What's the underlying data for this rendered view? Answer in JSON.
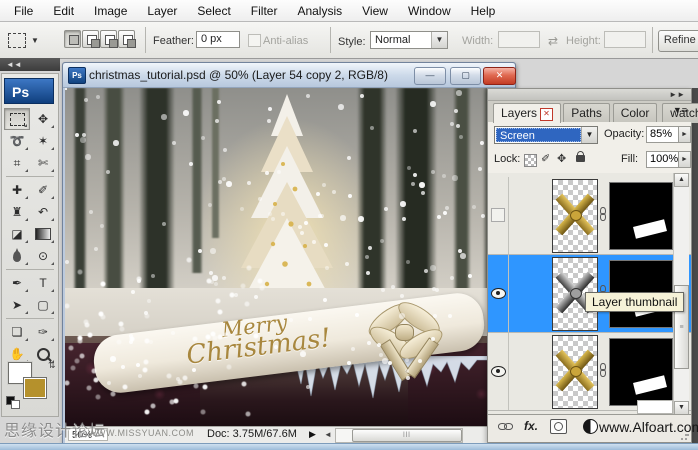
{
  "menu_bar": {
    "items": [
      "File",
      "Edit",
      "Image",
      "Layer",
      "Select",
      "Filter",
      "Analysis",
      "View",
      "Window",
      "Help"
    ]
  },
  "options_bar": {
    "feather_label": "Feather:",
    "feather_value": "0 px",
    "anti_alias_label": "Anti-alias",
    "style_label": "Style:",
    "style_value": "Normal",
    "width_label": "Width:",
    "width_value": "",
    "height_label": "Height:",
    "height_value": "",
    "refine_edge_label": "Refine E"
  },
  "toolbar": {
    "ps_logo": "Ps",
    "dock_collapse_icon": "left-double-chevron",
    "foreground_color": "#ffffff",
    "background_color": "#b5912c",
    "tools": [
      {
        "name": "rectangular-marquee-tool",
        "selected": true
      },
      {
        "name": "move-tool",
        "selected": false
      },
      {
        "name": "lasso-tool",
        "selected": false
      },
      {
        "name": "magic-wand-tool",
        "selected": false
      },
      {
        "name": "crop-tool",
        "selected": false
      },
      {
        "name": "slice-tool",
        "selected": false
      },
      {
        "name": "healing-brush-tool",
        "selected": false
      },
      {
        "name": "brush-tool",
        "selected": false
      },
      {
        "name": "clone-stamp-tool",
        "selected": false
      },
      {
        "name": "history-brush-tool",
        "selected": false
      },
      {
        "name": "eraser-tool",
        "selected": false
      },
      {
        "name": "gradient-tool",
        "selected": false
      },
      {
        "name": "blur-tool",
        "selected": false
      },
      {
        "name": "dodge-tool",
        "selected": false
      },
      {
        "name": "pen-tool",
        "selected": false
      },
      {
        "name": "type-tool",
        "selected": false
      },
      {
        "name": "path-selection-tool",
        "selected": false
      },
      {
        "name": "shape-tool",
        "selected": false
      },
      {
        "name": "notes-tool",
        "selected": false
      },
      {
        "name": "eyedropper-tool",
        "selected": false
      },
      {
        "name": "hand-tool",
        "selected": false
      },
      {
        "name": "zoom-tool",
        "selected": false
      }
    ]
  },
  "document_window": {
    "title": "christmas_tutorial.psd @ 50% (Layer 54 copy 2, RGB/8)",
    "icon": "Ps",
    "minimize_glyph": "—",
    "maximize_glyph": "▢",
    "close_glyph": "✕",
    "status_bar": {
      "zoom_value": "50%",
      "doc_info": "Doc: 3.75M/67.6M",
      "menu_arrow": "▶",
      "scroll_left_arrow": "◄",
      "scroll_grip": "lll"
    }
  },
  "canvas": {
    "greeting_line1": "Merry",
    "greeting_line2": "Christmas!"
  },
  "layers_panel": {
    "dock_collapse_icon": "right-double-chevron",
    "tabs": [
      {
        "label": "Layers",
        "active": true,
        "closable": true
      },
      {
        "label": "Paths",
        "active": false,
        "closable": false
      },
      {
        "label": "Color",
        "active": false,
        "closable": false
      },
      {
        "label": "watches",
        "active": false,
        "closable": false
      }
    ],
    "blend_mode_value": "Screen",
    "opacity_label": "Opacity:",
    "opacity_value": "85%",
    "lock_label": "Lock:",
    "fill_label": "Fill:",
    "fill_value": "100%",
    "tooltip": "Layer thumbnail",
    "layers": [
      {
        "thumbnail": "gold-bow",
        "visible": false,
        "selected": false,
        "linked_mask": true,
        "mask": "black-with-white-shape"
      },
      {
        "thumbnail": "silver-bow",
        "visible": true,
        "selected": true,
        "linked_mask": true,
        "mask": "black-with-white-shape"
      },
      {
        "thumbnail": "gold-bow",
        "visible": true,
        "selected": false,
        "linked_mask": true,
        "mask": "black-with-white-shape"
      }
    ],
    "bottom_icons": [
      "link-layers",
      "layer-styles",
      "add-layer-mask"
    ],
    "fx_label": "fx."
  },
  "watermarks": {
    "forum": "思缘设计论坛",
    "missyuan": "WWW.MISSYUAN.COM",
    "alfoart": "www.Alfoart.com"
  },
  "colors": {
    "selection_blue": "#2f96ff",
    "blend_highlight_blue": "#2f66c0",
    "close_button_red": "#c33c24",
    "background_swatch_gold": "#b5912c"
  }
}
